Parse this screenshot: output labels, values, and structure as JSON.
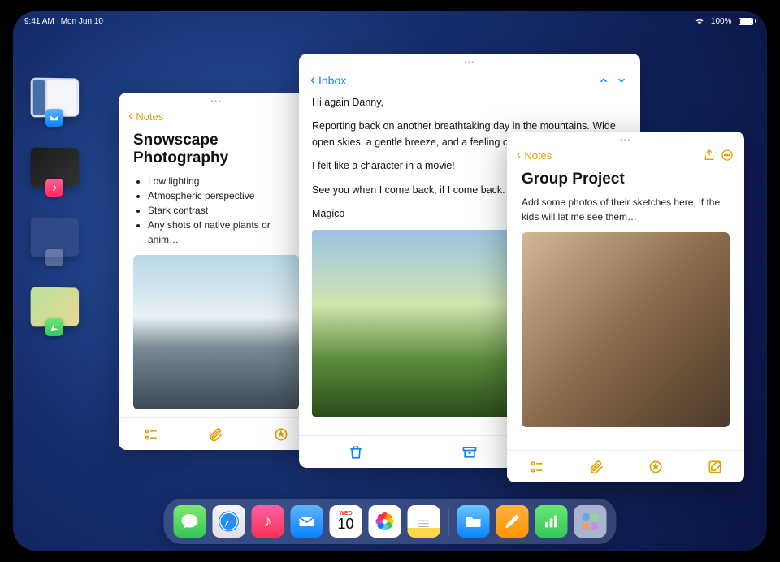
{
  "status": {
    "time": "9:41 AM",
    "date": "Mon Jun 10",
    "battery": "100%"
  },
  "stage_strip": [
    {
      "app": "mail"
    },
    {
      "app": "music"
    },
    {
      "app": "blank"
    },
    {
      "app": "maps"
    }
  ],
  "windows": {
    "note1": {
      "back_label": "Notes",
      "title": "Snowscape Photography",
      "bullets": [
        "Low lighting",
        "Atmospheric perspective",
        "Stark contrast",
        "Any shots of native plants or anim…"
      ]
    },
    "mail": {
      "back_label": "Inbox",
      "greeting": "Hi again Danny,",
      "p1": "Reporting back on another breathtaking day in the mountains. Wide open skies, a gentle breeze, and a feeling of adventure in the air.",
      "p2": "I felt like a character in a movie!",
      "p3": "See you when I come back, if I come back. 😉",
      "signoff": "Magico"
    },
    "note2": {
      "back_label": "Notes",
      "title": "Group Project",
      "body": "Add some photos of their sketches here, if the kids will let me see them…"
    }
  },
  "dock": {
    "calendar": {
      "month": "WED",
      "day": "10"
    },
    "apps": [
      "messages",
      "safari",
      "music",
      "mail",
      "calendar",
      "photos",
      "notes",
      "|",
      "files",
      "pages",
      "numbers",
      "apps"
    ]
  }
}
